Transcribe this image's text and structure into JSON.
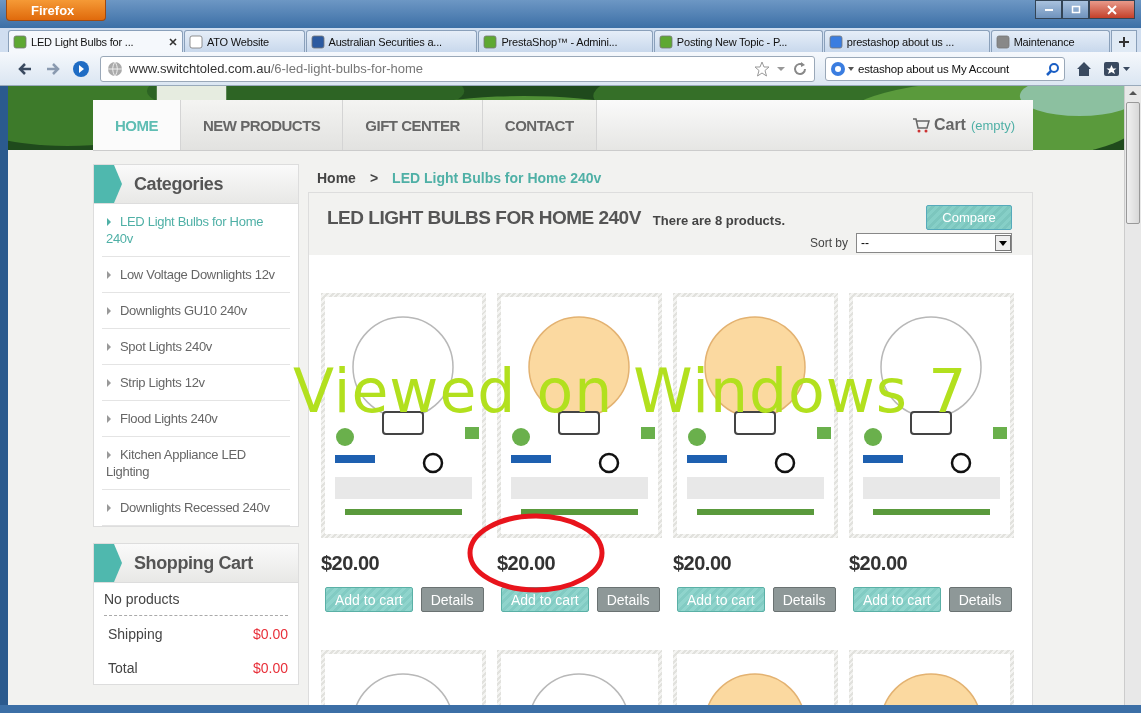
{
  "browser": {
    "menu_button": "Firefox",
    "tabs": [
      {
        "label": "LED Light Bulbs for ...",
        "selected": true
      },
      {
        "label": "ATO Website",
        "selected": false
      },
      {
        "label": "Australian Securities a...",
        "selected": false
      },
      {
        "label": "PrestaShop™ - Admini...",
        "selected": false
      },
      {
        "label": "Posting New Topic - P...",
        "selected": false
      },
      {
        "label": "prestashop about us ...",
        "selected": false
      },
      {
        "label": "Maintenance",
        "selected": false
      }
    ],
    "address": {
      "host": "www.switchtoled.com.au",
      "path": "/6-led-light-bulbs-for-home"
    },
    "search": {
      "value": "estashop about us My Account"
    }
  },
  "nav": {
    "items": [
      {
        "label": "HOME",
        "selected": true
      },
      {
        "label": "NEW PRODUCTS",
        "selected": false
      },
      {
        "label": "GIFT CENTER",
        "selected": false
      },
      {
        "label": "CONTACT",
        "selected": false
      }
    ],
    "cart": {
      "label": "Cart",
      "status": "(empty)"
    }
  },
  "sidebar": {
    "categories": {
      "title": "Categories",
      "items": [
        {
          "label": "LED Light Bulbs for Home 240v",
          "selected": true
        },
        {
          "label": "Low Voltage Downlights 12v",
          "selected": false
        },
        {
          "label": "Downlights GU10 240v",
          "selected": false
        },
        {
          "label": "Spot Lights 240v",
          "selected": false
        },
        {
          "label": "Strip Lights 12v",
          "selected": false
        },
        {
          "label": "Flood Lights 240v",
          "selected": false
        },
        {
          "label": "Kitchen Appliance LED Lighting",
          "selected": false
        },
        {
          "label": "Downlights Recessed 240v",
          "selected": false
        }
      ]
    },
    "cart": {
      "title": "Shopping Cart",
      "empty": "No products",
      "rows": [
        {
          "label": "Shipping",
          "value": "$0.00"
        },
        {
          "label": "Total",
          "value": "$0.00"
        }
      ]
    }
  },
  "breadcrumb": {
    "home": "Home",
    "separator": ">",
    "current": "LED Light Bulbs for Home 240v"
  },
  "listing": {
    "title": "LED LIGHT BULBS FOR HOME 240V",
    "count": "There are 8 products.",
    "compare": "Compare",
    "sort_label": "Sort by",
    "sort_value": "--",
    "products": [
      {
        "price": "$20.00",
        "add": "Add to cart",
        "details": "Details"
      },
      {
        "price": "$20.00",
        "add": "Add to cart",
        "details": "Details"
      },
      {
        "price": "$20.00",
        "add": "Add to cart",
        "details": "Details"
      },
      {
        "price": "$20.00",
        "add": "Add to cart",
        "details": "Details"
      }
    ]
  },
  "annotations": [
    {
      "kind": "text",
      "text": "Viewed on Windows 7",
      "color": "#b2e01e"
    },
    {
      "kind": "ellipse",
      "color": "#e8141c"
    }
  ]
}
